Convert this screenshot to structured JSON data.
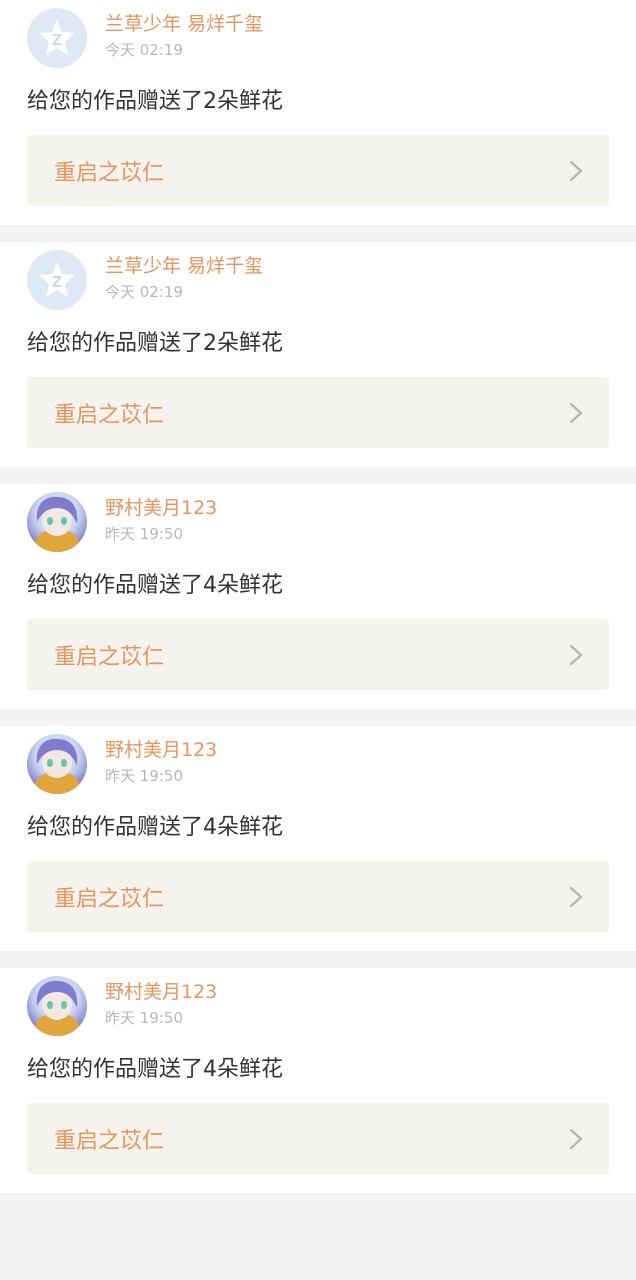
{
  "items": [
    {
      "username": "兰草少年 易烊千玺",
      "time": "今天 02:19",
      "message": "给您的作品赠送了2朵鲜花",
      "work_title": "重启之苡仁",
      "avatar": "default-avatar"
    },
    {
      "username": "兰草少年 易烊千玺",
      "time": "今天 02:19",
      "message": "给您的作品赠送了2朵鲜花",
      "work_title": "重启之苡仁",
      "avatar": "default-avatar"
    },
    {
      "username": "野村美月123",
      "time": "昨天 19:50",
      "message": "给您的作品赠送了4朵鲜花",
      "work_title": "重启之苡仁",
      "avatar": "anime-avatar"
    },
    {
      "username": "野村美月123",
      "time": "昨天 19:50",
      "message": "给您的作品赠送了4朵鲜花",
      "work_title": "重启之苡仁",
      "avatar": "anime-avatar"
    },
    {
      "username": "野村美月123",
      "time": "昨天 19:50",
      "message": "给您的作品赠送了4朵鲜花",
      "work_title": "重启之苡仁",
      "avatar": "anime-avatar"
    }
  ],
  "colors": {
    "accent": "#e8955e",
    "text": "#333333",
    "muted": "#b8b8b8",
    "link_bg": "#f4f3ee",
    "divider": "#f4f4f4"
  },
  "icons": {
    "chevron": "chevron-right-icon"
  }
}
